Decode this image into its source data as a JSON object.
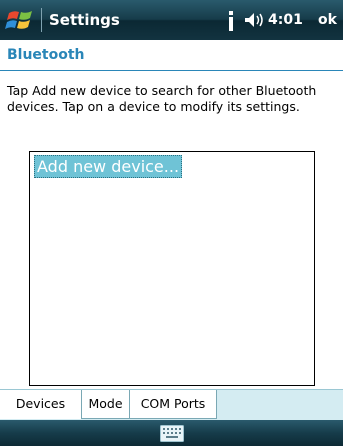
{
  "titlebar": {
    "title": "Settings",
    "time": "4:01",
    "ok_label": "ok",
    "start_icon": "windows-flag-icon",
    "connectivity_icon": "connectivity-icon",
    "volume_icon": "speaker-icon"
  },
  "page": {
    "title": "Bluetooth",
    "instructions": "Tap Add new device to search for other Bluetooth devices. Tap on a device to modify its settings."
  },
  "device_list": {
    "items": [
      {
        "label": "Add new device...",
        "selected": true
      }
    ]
  },
  "tabs": [
    {
      "label": "Devices",
      "active": true
    },
    {
      "label": "Mode",
      "active": false
    },
    {
      "label": "COM Ports",
      "active": false
    }
  ],
  "softkey": {
    "input_icon": "keyboard-icon"
  },
  "colors": {
    "accent": "#2a86b8",
    "selection": "#6fc3d6",
    "bar_dark": "#163c4a",
    "tab_bg": "#d4ecf2"
  }
}
